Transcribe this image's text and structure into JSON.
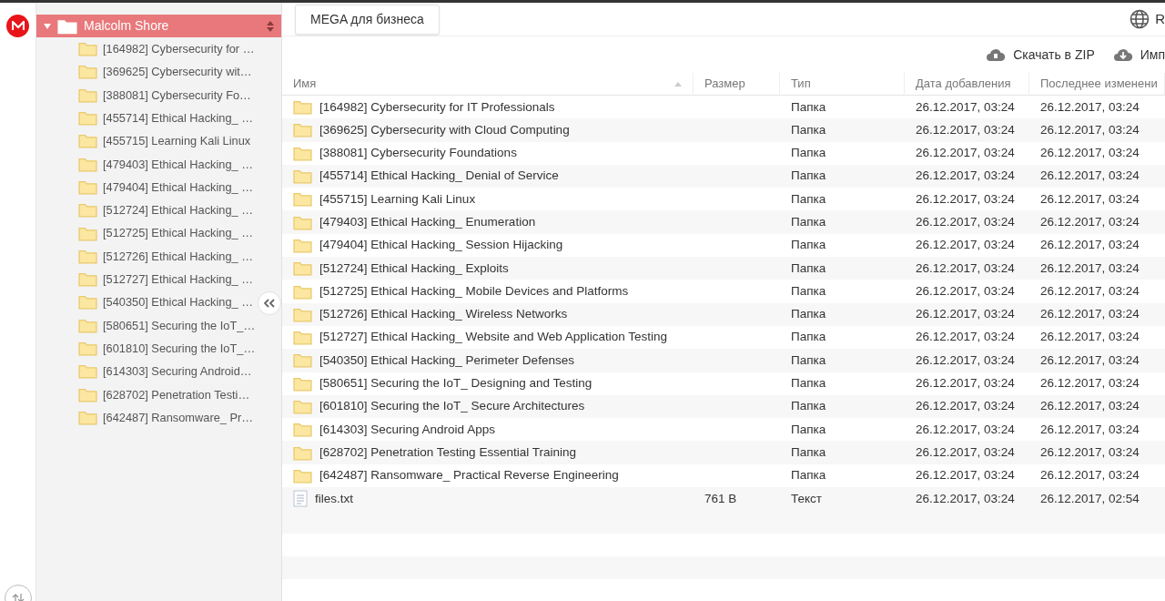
{
  "tree": {
    "root": {
      "label": "Malcolm Shore",
      "expanded": true
    },
    "items": [
      {
        "label": "[164982] Cybersecurity for …"
      },
      {
        "label": "[369625] Cybersecurity wit…"
      },
      {
        "label": "[388081] Cybersecurity Fo…"
      },
      {
        "label": "[455714] Ethical Hacking_ …"
      },
      {
        "label": "[455715] Learning Kali Linux"
      },
      {
        "label": "[479403] Ethical Hacking_ …"
      },
      {
        "label": "[479404] Ethical Hacking_ …"
      },
      {
        "label": "[512724] Ethical Hacking_ …"
      },
      {
        "label": "[512725] Ethical Hacking_ …"
      },
      {
        "label": "[512726] Ethical Hacking_ …"
      },
      {
        "label": "[512727] Ethical Hacking_ …"
      },
      {
        "label": "[540350] Ethical Hacking_ …"
      },
      {
        "label": "[580651] Securing the IoT_…"
      },
      {
        "label": "[601810] Securing the IoT_…"
      },
      {
        "label": "[614303] Securing Android…"
      },
      {
        "label": "[628702] Penetration Testi…"
      },
      {
        "label": "[642487] Ransomware_ Pr…"
      }
    ]
  },
  "topbar": {
    "business_button": "MEGA для бизнеса",
    "language": "R"
  },
  "actions": [
    "Скачать в ZIP",
    "Имп"
  ],
  "table": {
    "columns": [
      {
        "label": "Имя",
        "sorted": true
      },
      {
        "label": "Размер",
        "sorted": false
      },
      {
        "label": "Тип",
        "sorted": false
      },
      {
        "label": "Дата добавления",
        "sorted": false
      },
      {
        "label": "Последнее изменени",
        "sorted": false
      }
    ],
    "rows": [
      {
        "kind": "folder",
        "name": "[164982] Cybersecurity for IT Professionals",
        "type": "Папка",
        "added": "26.12.2017, 03:24",
        "modified": "26.12.2017, 03:24"
      },
      {
        "kind": "folder",
        "name": "[369625] Cybersecurity with Cloud Computing",
        "type": "Папка",
        "added": "26.12.2017, 03:24",
        "modified": "26.12.2017, 03:24"
      },
      {
        "kind": "folder",
        "name": "[388081] Cybersecurity Foundations",
        "type": "Папка",
        "added": "26.12.2017, 03:24",
        "modified": "26.12.2017, 03:24"
      },
      {
        "kind": "folder",
        "name": "[455714] Ethical Hacking_ Denial of Service",
        "type": "Папка",
        "added": "26.12.2017, 03:24",
        "modified": "26.12.2017, 03:24"
      },
      {
        "kind": "folder",
        "name": "[455715] Learning Kali Linux",
        "type": "Папка",
        "added": "26.12.2017, 03:24",
        "modified": "26.12.2017, 03:24"
      },
      {
        "kind": "folder",
        "name": "[479403] Ethical Hacking_ Enumeration",
        "type": "Папка",
        "added": "26.12.2017, 03:24",
        "modified": "26.12.2017, 03:24"
      },
      {
        "kind": "folder",
        "name": "[479404] Ethical Hacking_ Session Hijacking",
        "type": "Папка",
        "added": "26.12.2017, 03:24",
        "modified": "26.12.2017, 03:24"
      },
      {
        "kind": "folder",
        "name": "[512724] Ethical Hacking_ Exploits",
        "type": "Папка",
        "added": "26.12.2017, 03:24",
        "modified": "26.12.2017, 03:24"
      },
      {
        "kind": "folder",
        "name": "[512725] Ethical Hacking_ Mobile Devices and Platforms",
        "type": "Папка",
        "added": "26.12.2017, 03:24",
        "modified": "26.12.2017, 03:24"
      },
      {
        "kind": "folder",
        "name": "[512726] Ethical Hacking_ Wireless Networks",
        "type": "Папка",
        "added": "26.12.2017, 03:24",
        "modified": "26.12.2017, 03:24"
      },
      {
        "kind": "folder",
        "name": "[512727] Ethical Hacking_ Website and Web Application Testing",
        "type": "Папка",
        "added": "26.12.2017, 03:24",
        "modified": "26.12.2017, 03:24"
      },
      {
        "kind": "folder",
        "name": "[540350] Ethical Hacking_ Perimeter Defenses",
        "type": "Папка",
        "added": "26.12.2017, 03:24",
        "modified": "26.12.2017, 03:24"
      },
      {
        "kind": "folder",
        "name": "[580651] Securing the IoT_ Designing and Testing",
        "type": "Папка",
        "added": "26.12.2017, 03:24",
        "modified": "26.12.2017, 03:24"
      },
      {
        "kind": "folder",
        "name": "[601810] Securing the IoT_ Secure Architectures",
        "type": "Папка",
        "added": "26.12.2017, 03:24",
        "modified": "26.12.2017, 03:24"
      },
      {
        "kind": "folder",
        "name": "[614303] Securing Android Apps",
        "type": "Папка",
        "added": "26.12.2017, 03:24",
        "modified": "26.12.2017, 03:24"
      },
      {
        "kind": "folder",
        "name": "[628702] Penetration Testing Essential Training",
        "type": "Папка",
        "added": "26.12.2017, 03:24",
        "modified": "26.12.2017, 03:24"
      },
      {
        "kind": "folder",
        "name": "[642487] Ransomware_ Practical Reverse Engineering",
        "type": "Папка",
        "added": "26.12.2017, 03:24",
        "modified": "26.12.2017, 03:24"
      },
      {
        "kind": "file",
        "name": "files.txt",
        "size": "761 B",
        "type": "Текст",
        "added": "26.12.2017, 03:24",
        "modified": "26.12.2017, 02:54"
      }
    ]
  }
}
